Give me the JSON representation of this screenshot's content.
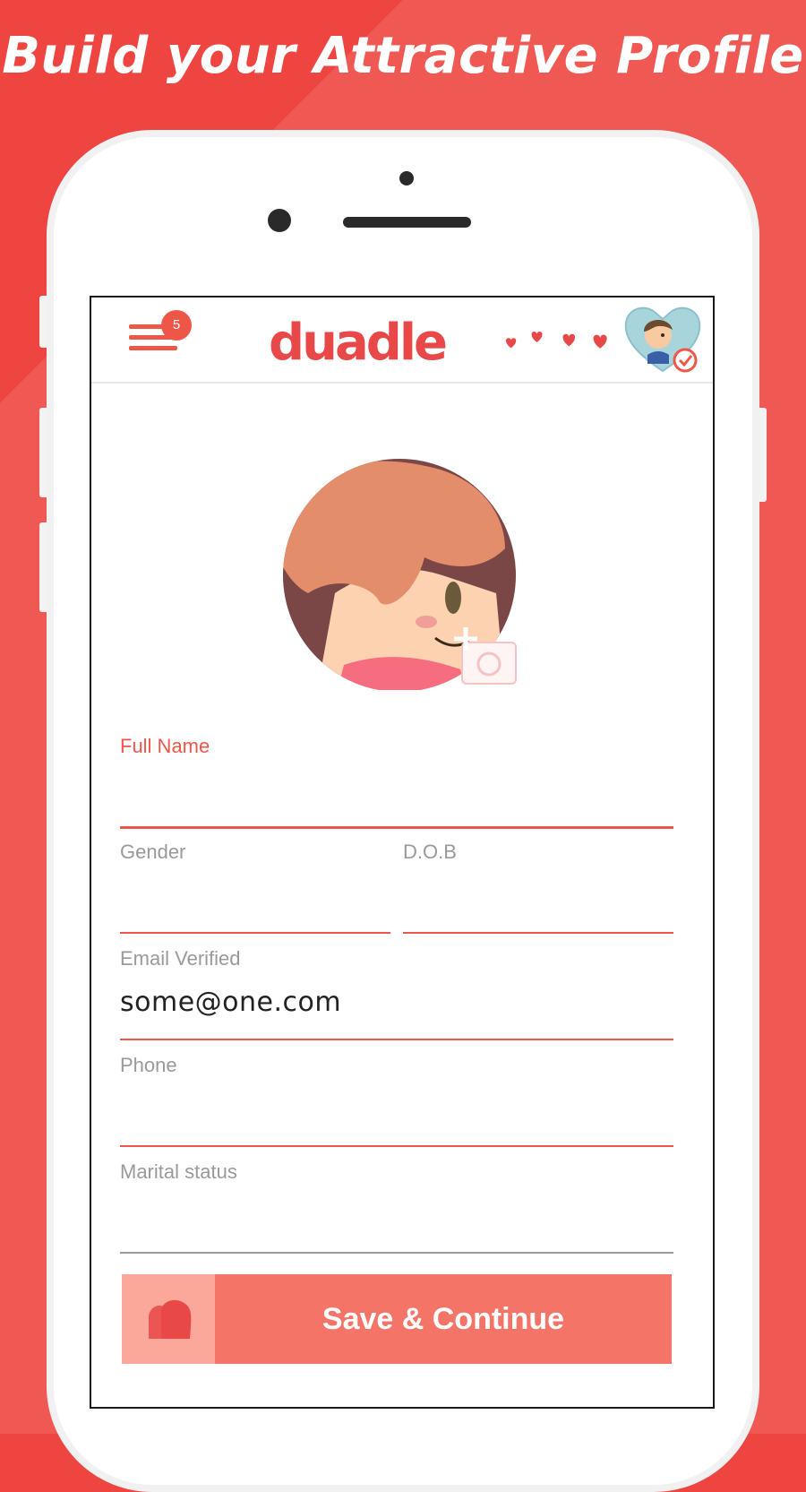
{
  "promo": {
    "title": "Build your Attractive Profile"
  },
  "header": {
    "menu_badge": "5",
    "brand": "duadle"
  },
  "form": {
    "full_name": {
      "label": "Full Name",
      "value": ""
    },
    "gender": {
      "label": "Gender",
      "value": ""
    },
    "dob": {
      "label": "D.O.B",
      "value": ""
    },
    "email": {
      "label": "Email Verified",
      "value": "some@one.com"
    },
    "phone": {
      "label": "Phone",
      "value": ""
    },
    "marital_status": {
      "label": "Marital status",
      "value": ""
    }
  },
  "actions": {
    "save_label": "Save & Continue"
  },
  "icons": {
    "menu": "hamburger-icon",
    "camera": "camera-add-icon",
    "verified": "check-circle-icon",
    "button": "heart-icon"
  },
  "colors": {
    "background": "#ee4540",
    "accent": "#ee5748",
    "button": "#f47467",
    "button_icon_bg": "#fba89b",
    "label_grey": "#9a9a9a"
  }
}
